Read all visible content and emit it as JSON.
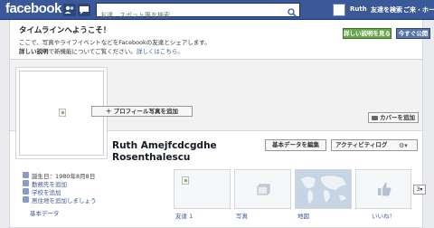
{
  "topbar": {
    "logo": "facebook",
    "search_placeholder": "友達、スポット等を検索",
    "user_name": "Ruth",
    "friends_request_label": "友達を検索",
    "home_label": "ご来・ホーム"
  },
  "welcome": {
    "title": "タイムラインへようこそ！",
    "line1": "ここで、写真やライフイベントなどをFacebookの友達とシェアします。",
    "line2_bold": "詳しい説明",
    "line2_rest": "で新機能についてご覧ください。",
    "line2_link": "詳しくはこちら。",
    "learn_more_button": "詳しい説明を見る",
    "publish_button": "今すぐ公開"
  },
  "cover": {
    "add_profile_photo_button": "＋ プロフィール写真を追加",
    "add_cover_button": "カバーを追加"
  },
  "profile": {
    "name": "Ruth Amejfcdcgdhe Rosenthalescu",
    "edit_basic_button": "基本データを編集",
    "activity_log_button": "アクティビティログ",
    "info": [
      {
        "text": "誕生日：1980年8月8日",
        "link": false
      },
      {
        "text": "勤務先を追加",
        "link": true
      },
      {
        "text": "学校を追加",
        "link": true
      },
      {
        "text": "居住地を追加しましょう",
        "link": true
      }
    ],
    "basic_data_label": "基本データ",
    "tiles": [
      "友達 1",
      "写真",
      "地図",
      "いいね！"
    ],
    "more_button": "3"
  }
}
